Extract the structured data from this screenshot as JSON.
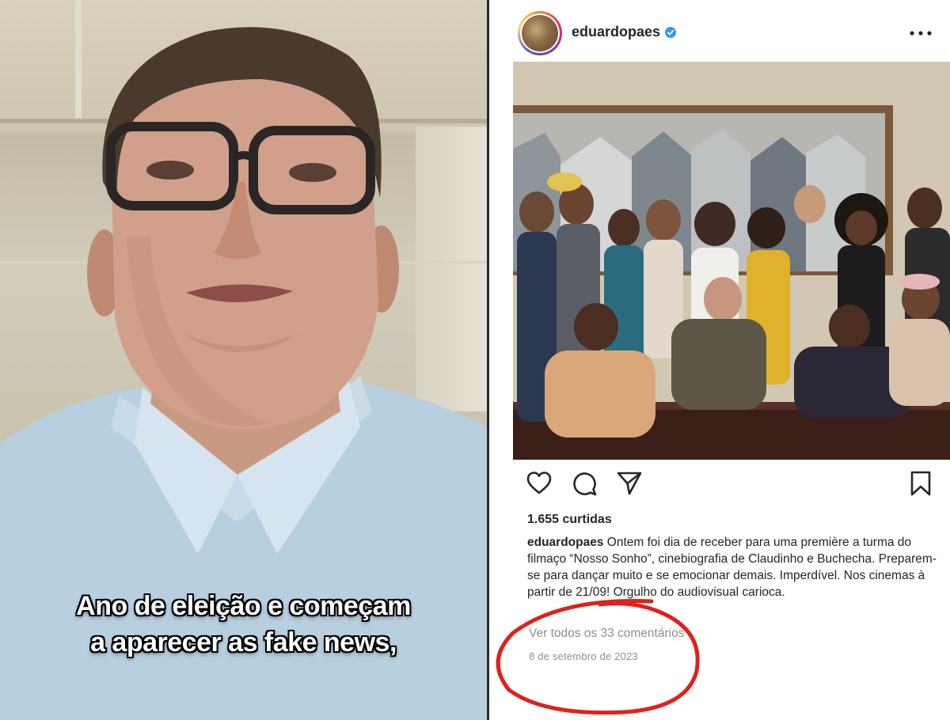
{
  "video": {
    "caption_line_1": "Ano de eleição e começam",
    "caption_line_2": "a aparecer as fake news,"
  },
  "post": {
    "username": "eduardopaes",
    "verified": true,
    "likes": "1.655 curtidas",
    "caption": "Ontem foi dia de receber para uma première a turma do filmaço “Nosso Sonho”, cinebiografia de Claudinho e Buchecha.  Preparem-se para dançar muito e se emocionar demais.  Imperdível.  Nos cinemas à partir de 21/09! Orgulho do audiovisual carioca.",
    "view_comments": "Ver todos os 33 comentários",
    "date": "8 de setembro de 2023"
  },
  "icons": {
    "like": "heart-icon",
    "comment": "comment-icon",
    "share": "paper-plane-icon",
    "save": "bookmark-icon",
    "more": "more-options-icon",
    "verified": "verified-badge-icon"
  },
  "colors": {
    "verified_blue": "#3897f0",
    "annotation_red": "#e0201b",
    "text_primary": "#262626",
    "text_secondary": "#8e8e8e"
  }
}
